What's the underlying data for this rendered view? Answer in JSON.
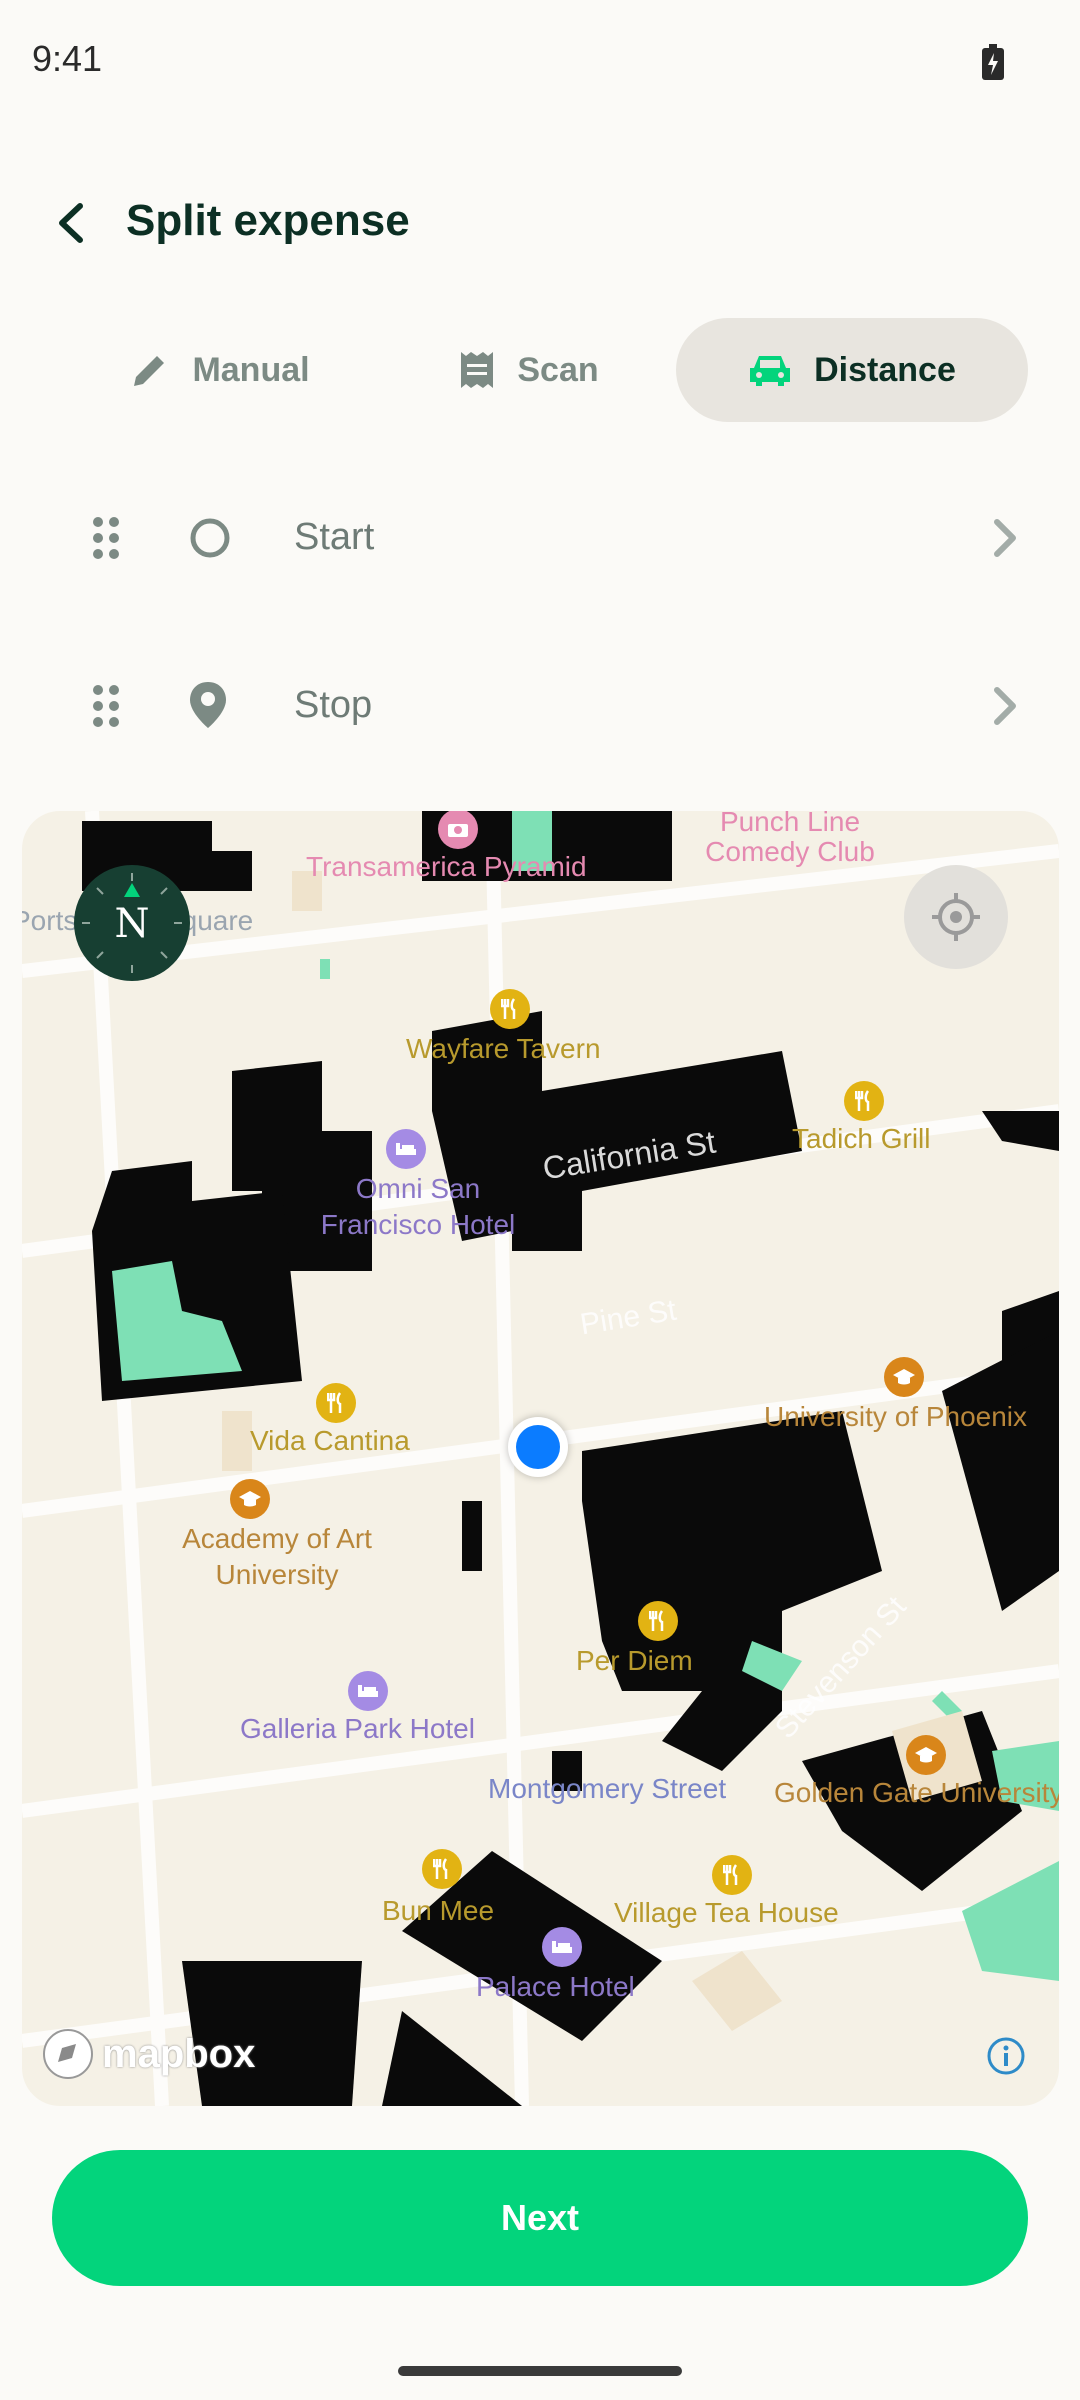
{
  "status_bar": {
    "time": "9:41"
  },
  "header": {
    "title": "Split expense"
  },
  "tabs": [
    {
      "label": "Manual",
      "icon": "pencil-icon",
      "active": false
    },
    {
      "label": "Scan",
      "icon": "receipt-icon",
      "active": false
    },
    {
      "label": "Distance",
      "icon": "car-icon",
      "active": true
    }
  ],
  "waypoints": [
    {
      "label": "Start",
      "icon": "circle-icon"
    },
    {
      "label": "Stop",
      "icon": "location-pin-icon"
    }
  ],
  "map": {
    "compass_letter": "N",
    "attribution": "mapbox",
    "pois": [
      {
        "name": "Transamerica Pyramid",
        "kind": "attraction"
      },
      {
        "name": "Punch Line Comedy Club",
        "kind": "attraction"
      },
      {
        "name": "Portsmouth Square",
        "kind": "park"
      },
      {
        "name": "Wayfare Tavern",
        "kind": "food"
      },
      {
        "name": "Tadich Grill",
        "kind": "food"
      },
      {
        "name": "Omni San Francisco Hotel",
        "kind": "hotel"
      },
      {
        "name": "Vida Cantina",
        "kind": "food"
      },
      {
        "name": "Academy of Art University",
        "kind": "education"
      },
      {
        "name": "University of Phoenix",
        "kind": "education"
      },
      {
        "name": "Per Diem",
        "kind": "food"
      },
      {
        "name": "Galleria Park Hotel",
        "kind": "hotel"
      },
      {
        "name": "Montgomery Street",
        "kind": "transit"
      },
      {
        "name": "Golden Gate University",
        "kind": "education"
      },
      {
        "name": "Bun Mee",
        "kind": "food"
      },
      {
        "name": "Village Tea House",
        "kind": "food"
      },
      {
        "name": "Palace Hotel",
        "kind": "hotel"
      }
    ],
    "streets": [
      "California St",
      "Pine St",
      "Stevenson St"
    ]
  },
  "footer": {
    "next_label": "Next"
  },
  "colors": {
    "accent": "#03D47C",
    "dark": "#0C2F24",
    "location_dot": "#0B7CFF"
  }
}
